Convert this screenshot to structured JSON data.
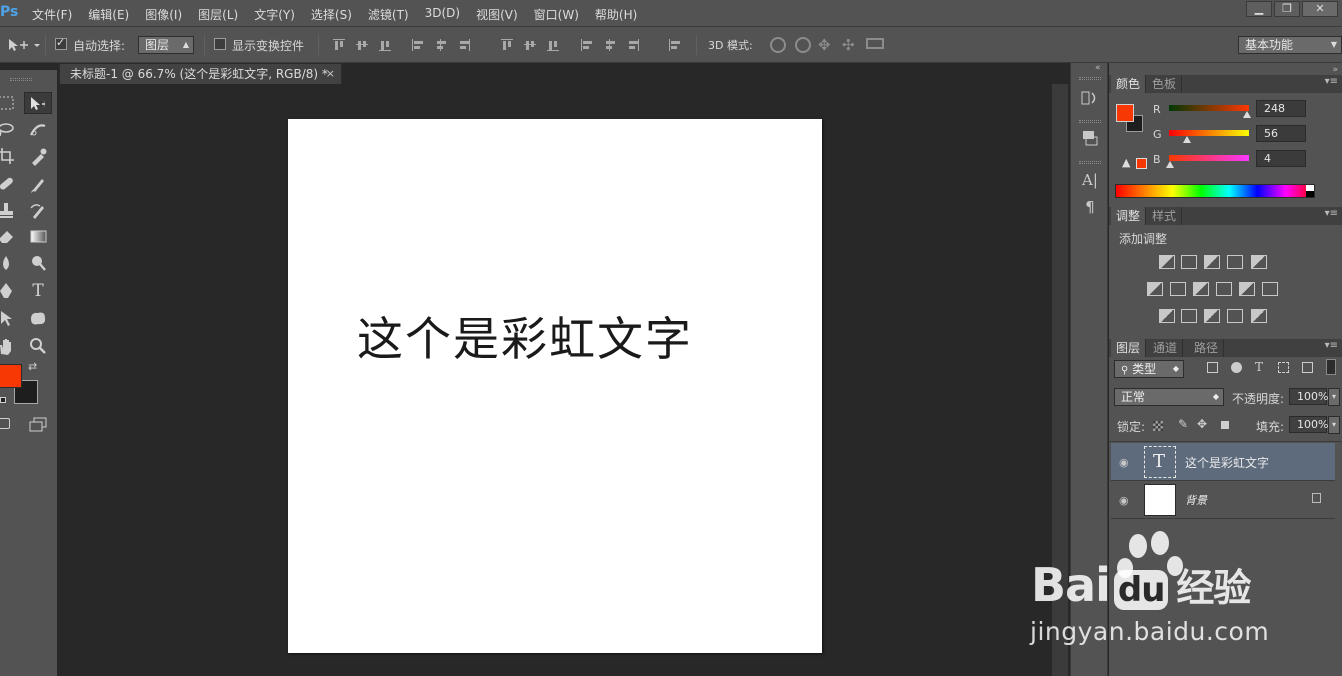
{
  "app": {
    "logo": "Ps",
    "accent": "#4ea3e8"
  },
  "menu": [
    "文件(F)",
    "编辑(E)",
    "图像(I)",
    "图层(L)",
    "文字(Y)",
    "选择(S)",
    "滤镜(T)",
    "3D(D)",
    "视图(V)",
    "窗口(W)",
    "帮助(H)"
  ],
  "window_controls": {
    "minimize": "▁",
    "restore": "❐",
    "close": "✕"
  },
  "options_bar": {
    "auto_select_label": "自动选择:",
    "auto_select_checked": true,
    "auto_select_target": "图层",
    "show_transform_label": "显示变换控件",
    "show_transform_checked": false,
    "mode_3d_label": "3D 模式:",
    "workspace": "基本功能"
  },
  "document": {
    "tab_title": "未标题-1 @ 66.7% (这个是彩虹文字, RGB/8) *",
    "close": "×",
    "canvas_text": "这个是彩虹文字"
  },
  "colors": {
    "foreground": "#f83804",
    "background": "#1e1e1e"
  },
  "color_panel": {
    "tabs": [
      "颜色",
      "色板"
    ],
    "channels": [
      {
        "label": "R",
        "value": "248",
        "fraction": 0.973
      },
      {
        "label": "G",
        "value": "56",
        "fraction": 0.22
      },
      {
        "label": "B",
        "value": "4",
        "fraction": 0.016
      }
    ]
  },
  "adjustments_panel": {
    "tabs": [
      "调整",
      "样式"
    ],
    "heading": "添加调整"
  },
  "layers_panel": {
    "tabs": [
      "图层",
      "通道",
      "路径"
    ],
    "filter_kind": "类型",
    "blend_mode": "正常",
    "opacity_label": "不透明度:",
    "opacity": "100%",
    "lock_label": "锁定:",
    "fill_label": "填充:",
    "fill": "100%",
    "layers": [
      {
        "name": "这个是彩虹文字",
        "type": "text",
        "thumb_glyph": "T",
        "selected": true
      },
      {
        "name": "背景",
        "type": "background",
        "locked": true,
        "selected": false
      }
    ]
  },
  "dock_icons": [
    "history-icon",
    "layer-comps-icon",
    "character-icon",
    "paragraph-icon"
  ],
  "watermark": {
    "brand": "Bai",
    "brand2": "du",
    "suffix": "经验",
    "url": "jingyan.baidu.com"
  }
}
